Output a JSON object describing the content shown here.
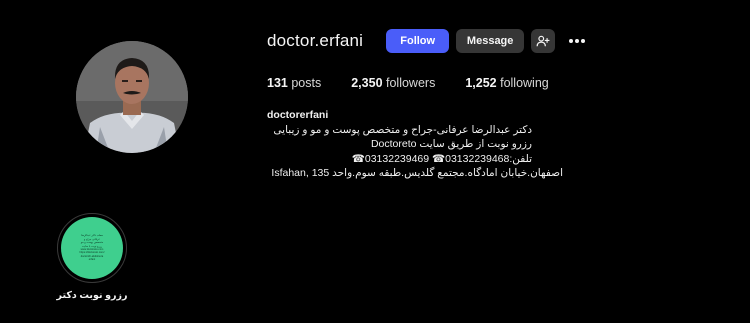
{
  "profile": {
    "username": "doctor.erfani",
    "follow_label": "Follow",
    "message_label": "Message",
    "posts_count": "131",
    "posts_label": "posts",
    "followers_count": "2,350",
    "followers_label": "followers",
    "following_count": "1,252",
    "following_label": "following"
  },
  "bio": {
    "name": "doctorerfani",
    "line1": "دکتر عبدالرضا عرفانی-جراح و متخصص پوست و مو و زیبایی",
    "line2": "رزرو نوبت از طریق سایت Doctoreto",
    "line3": "تلفن:03132239468☎ 03132239469☎",
    "line4": "اصفهان.خیابان امادگاه.مجتمع گلدیس.طبقه سوم.واحد 135 ,Isfahan"
  },
  "highlight": {
    "label": "رزرو نوبت دکتر",
    "inner_text": [
      "مطب دکتر عبدالرضا",
      "عرفانی جراح و",
      "متخصص پوست و مو",
      "رزرو نوبت با سایت",
      "www.doctoreto.com",
      "https://doctoreto.com/",
      "doctor/dr-abdolreza",
      "erfani"
    ]
  },
  "colors": {
    "background": "#000000",
    "follow_button": "#4a5df9",
    "secondary_button": "#363636",
    "highlight_fill": "#3fcf8e"
  },
  "icons": {
    "add_user": "add-user-icon",
    "more": "more-options-icon"
  }
}
